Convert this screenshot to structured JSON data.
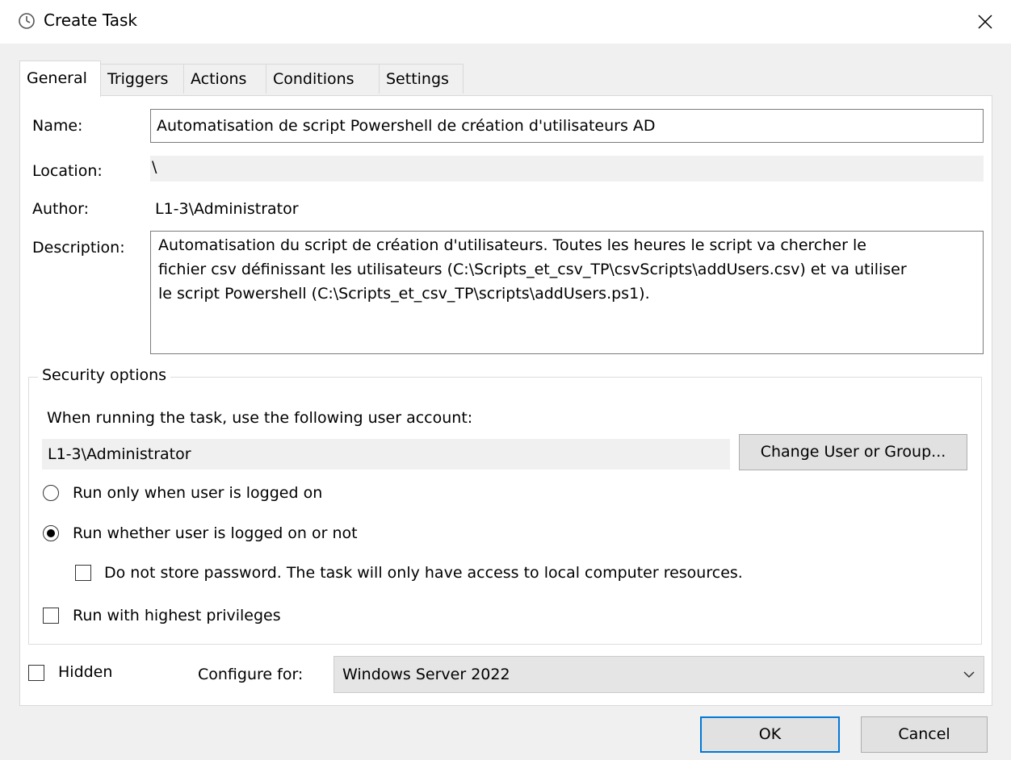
{
  "window": {
    "title": "Create Task",
    "close_glyph": "✕",
    "icon": "task-scheduler-clock-icon"
  },
  "tabs": [
    {
      "label": "General",
      "active": true
    },
    {
      "label": "Triggers",
      "active": false
    },
    {
      "label": "Actions",
      "active": false
    },
    {
      "label": "Conditions",
      "active": false
    },
    {
      "label": "Settings",
      "active": false
    }
  ],
  "general": {
    "name_label": "Name:",
    "name_value": "Automatisation de script Powershell de création d'utilisateurs AD",
    "location_label": "Location:",
    "location_value": "\\",
    "author_label": "Author:",
    "author_value": "L1-3\\Administrator",
    "description_label": "Description:",
    "description_lines": [
      "Automatisation du script de création d'utilisateurs. Toutes les heures le script va chercher le",
      "fichier csv définissant les utilisateurs (C:\\Scripts_et_csv_TP\\csvScripts\\addUsers.csv) et va utiliser",
      "le script Powershell (C:\\Scripts_et_csv_TP\\scripts\\addUsers.ps1)."
    ]
  },
  "security": {
    "legend": "Security options",
    "account_prompt": "When running the task, use the following user account:",
    "account_value": "L1-3\\Administrator",
    "change_button": "Change User or Group...",
    "radio_logged_on": {
      "label": "Run only when user is logged on",
      "checked": false
    },
    "radio_whether": {
      "label": "Run whether user is logged on or not",
      "checked": true
    },
    "no_store_password": {
      "label": "Do not store password.  The task will only have access to local computer resources.",
      "checked": false
    },
    "highest_privileges": {
      "label": "Run with highest privileges",
      "checked": false
    }
  },
  "footer": {
    "hidden": {
      "label": "Hidden",
      "checked": false
    },
    "configure_label": "Configure for:",
    "configure_value": "Windows Server 2022",
    "ok": "OK",
    "cancel": "Cancel"
  },
  "colors": {
    "default_button_border": "#0078d7",
    "panel_bg": "#ffffff",
    "dialog_bg": "#f0f0f0"
  }
}
